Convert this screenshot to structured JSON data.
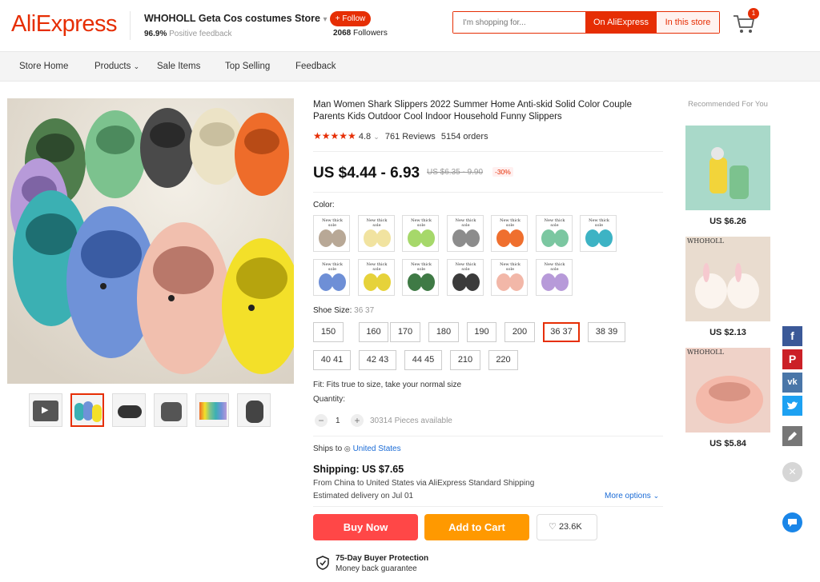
{
  "header": {
    "logo": "AliExpress",
    "store_name": "WHOHOLL Geta Cos costumes Store",
    "feedback_value": "96.9%",
    "feedback_label": "Positive feedback",
    "follow_label": "+ Follow",
    "followers_count": "2068",
    "followers_label": "Followers",
    "search_placeholder": "I'm shopping for...",
    "search_ali_label": "On AliExpress",
    "search_store_label": "In this store",
    "cart_count": "1",
    "accent": "#e62e04"
  },
  "nav": [
    "Store Home",
    "Products",
    "Sale Items",
    "Top Selling",
    "Feedback"
  ],
  "product": {
    "title": "Man Women Shark Slippers 2022 Summer Home Anti-skid Solid Color Couple Parents Kids Outdoor Cool Indoor Household Funny Slippers",
    "rating_value": "4.8",
    "reviews": "761 Reviews",
    "orders": "5154 orders",
    "price": "US $4.44 - 6.93",
    "original_price": "US $6.35 - 9.90",
    "discount": "-30%",
    "color_label": "Color:",
    "swatch_caption": "New thick sole",
    "colors": [
      "#b8a896",
      "#f1e3a0",
      "#a6d86a",
      "#8c8c8c",
      "#ef6f2e",
      "#7bc7a1",
      "#3db3c4",
      "#6e8fd6",
      "#e6d23a",
      "#3f7a45",
      "#3b3b3b",
      "#f2b7a8",
      "#b79ad9"
    ],
    "size_label": "Shoe Size:",
    "size_selected": "36 37",
    "sizes_row1": [
      "150",
      "160",
      "170",
      "180",
      "190",
      "200",
      "36 37",
      "38 39"
    ],
    "sizes_row2": [
      "40 41",
      "42 43",
      "44 45",
      "210",
      "220"
    ],
    "fit_text": "Fit: Fits true to size, take your normal size",
    "quantity_label": "Quantity:",
    "quantity_value": "1",
    "pieces_available": "30314 Pieces available",
    "ships_to_label": "Ships to",
    "ships_to_country": "United States",
    "shipping_title": "Shipping: US $7.65",
    "shipping_route_prefix": "From China to United States via",
    "shipping_method": "AliExpress Standard Shipping",
    "delivery": "Estimated delivery on Jul 01",
    "more_options": "More options",
    "buy_now": "Buy Now",
    "add_to_cart": "Add to Cart",
    "wishlist_count": "23.6K",
    "protection_title": "75-Day Buyer Protection",
    "protection_sub": "Money back guarantee"
  },
  "recommended": {
    "title": "Recommended For You",
    "items": [
      {
        "price": "US $6.26"
      },
      {
        "price": "US $2.13",
        "brand": "WHOHOLL"
      },
      {
        "price": "US $5.84",
        "brand": "WHOHOLL"
      }
    ]
  },
  "social": {
    "facebook": "f",
    "pinterest": "P",
    "vk": "vk",
    "twitter_color": "#1da1f2"
  }
}
